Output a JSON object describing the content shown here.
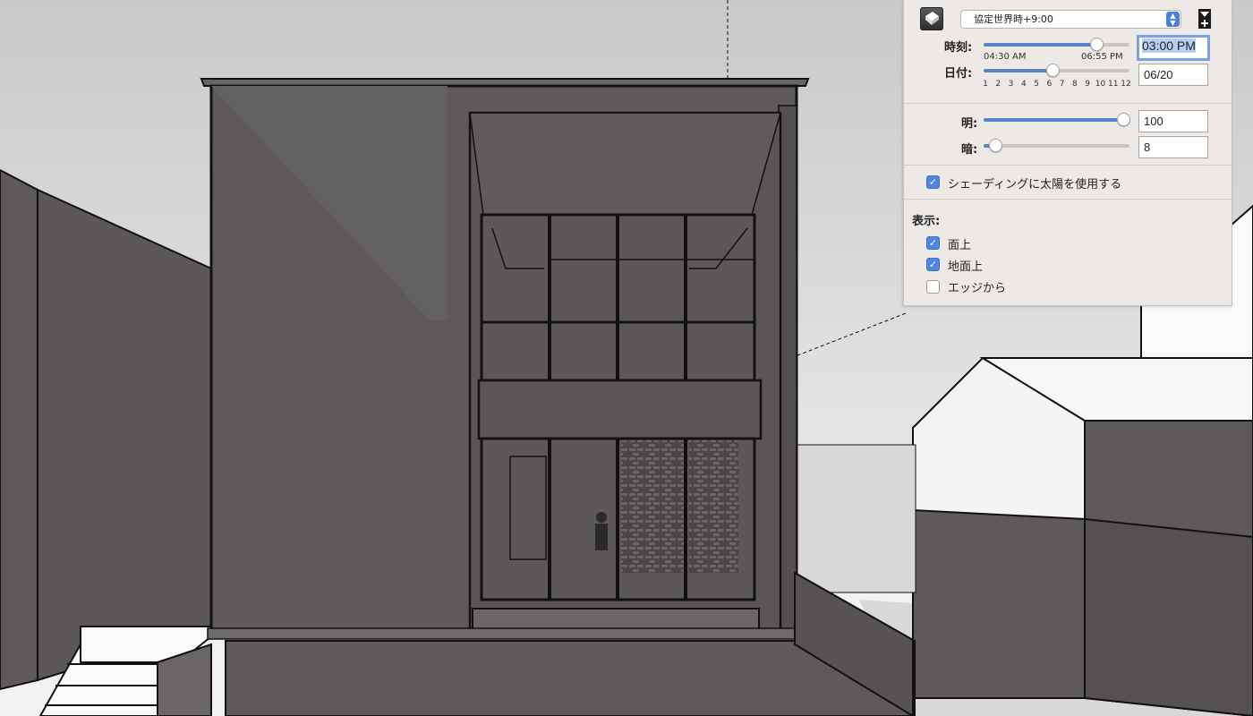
{
  "shadows_panel": {
    "timezone": "協定世界時+9:00",
    "time": {
      "label": "時刻:",
      "min_label": "04:30 AM",
      "max_label": "06:55 PM",
      "value": "03:00 PM",
      "slider_fraction": 0.77
    },
    "date": {
      "label": "日付:",
      "value": "06/20",
      "months": [
        "1",
        "2",
        "3",
        "4",
        "5",
        "6",
        "7",
        "8",
        "9",
        "10",
        "11",
        "12"
      ],
      "slider_fraction": 0.47
    },
    "light": {
      "label": "明:",
      "value": "100",
      "slider_fraction": 1.0
    },
    "dark": {
      "label": "暗:",
      "value": "8",
      "slider_fraction": 0.08
    },
    "use_sun_shading": {
      "label": "シェーディングに太陽を使用する",
      "checked": true
    },
    "display": {
      "heading": "表示:",
      "options": [
        {
          "label": "面上",
          "checked": true
        },
        {
          "label": "地面上",
          "checked": true
        },
        {
          "label": "エッジから",
          "checked": false
        }
      ]
    }
  },
  "colors": {
    "accent": "#4f86e0",
    "building": "#5e5a5c",
    "sky": "#dedede"
  }
}
